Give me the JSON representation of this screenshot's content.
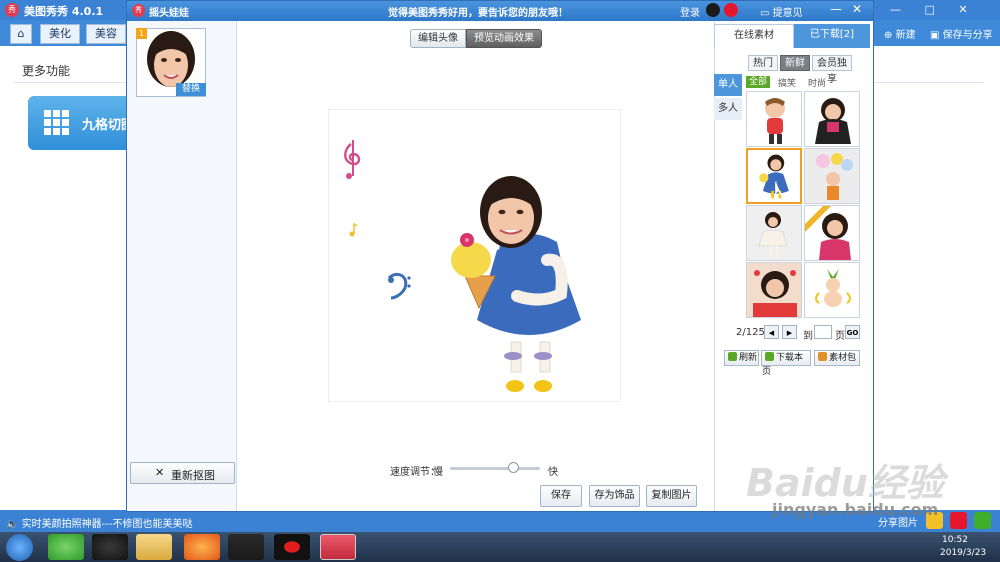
{
  "app": {
    "title": "美图秀秀 4.0.1",
    "tabs": [
      "美化",
      "美容"
    ],
    "more_features": "更多功能",
    "grid_cut": "九格切图",
    "new": "新建",
    "save_share": "保存与分享",
    "share_image": "分享图片",
    "window_buttons": "— □ ✕"
  },
  "dialog": {
    "title": "摇头娃娃",
    "slogan": "觉得美图秀秀好用，要告诉您的朋友哦！",
    "login": "登录",
    "feedback": "提意见",
    "min": "—",
    "close": "✕",
    "thumb_badge": "1",
    "replace": "替换",
    "recut": "重新抠图",
    "tabs": {
      "edit": "编辑头像",
      "preview": "预览动画效果"
    },
    "speed": {
      "label": "速度调节：",
      "slow": "慢",
      "fast": "快",
      "value": 0.7
    },
    "buttons": {
      "save": "保存",
      "save_as_decoration": "存为饰品",
      "copy_image": "复制图片"
    }
  },
  "materials": {
    "tabs": {
      "online": "在线素材",
      "downloaded": "已下载[2]"
    },
    "filters": [
      "热门",
      "新鲜",
      "会员独享"
    ],
    "active_filter": "新鲜",
    "subfilters": [
      "全部",
      "搞笑",
      "时尚"
    ],
    "side_tabs": [
      "单人",
      "多人"
    ],
    "pager": {
      "text": "2/125",
      "prev": "◀",
      "next": "▶",
      "to": "到",
      "page": "页",
      "go": "GO"
    },
    "actions": {
      "refresh": "刷新",
      "download_page": "下载本页",
      "pack": "素材包"
    }
  },
  "status_bar": {
    "left": "实时美颜拍照神器---不修图也能美美哒"
  },
  "taskbar": {
    "time": "10:52",
    "date": "2019/3/23"
  },
  "watermark": {
    "logo": "Baidu经验",
    "url": "jingyan.baidu.com"
  },
  "colors": {
    "title_blue": "#3b82d4",
    "accent_green": "#5aa827",
    "selected_border": "#f0a020"
  },
  "icons": [
    "qq-icon",
    "weibo-icon",
    "refresh-icon",
    "download-icon",
    "package-icon",
    "home-icon",
    "grid-icon",
    "windows-start-icon"
  ]
}
